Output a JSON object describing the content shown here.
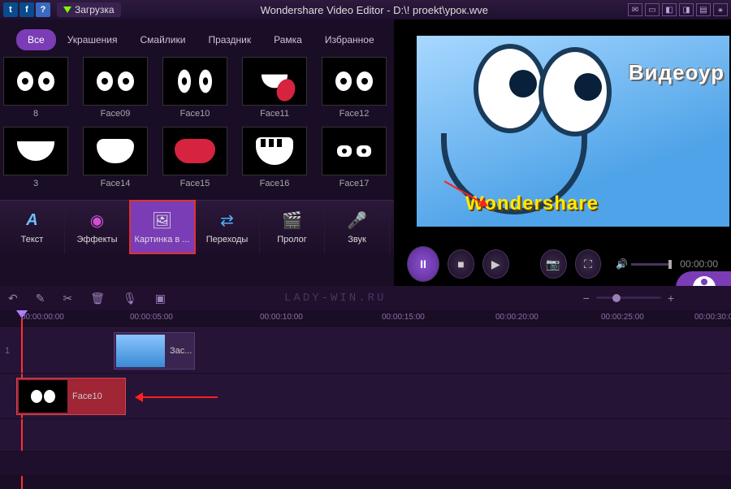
{
  "titlebar": {
    "download": "Загрузка",
    "title": "Wondershare Video Editor - D:\\! proekt\\урок.wve"
  },
  "categories": [
    "Все",
    "Украшения",
    "Смайлики",
    "Праздник",
    "Рамка",
    "Избранное"
  ],
  "active_category": 0,
  "thumbs": {
    "row1": [
      "8",
      "Face09",
      "Face10",
      "Face11",
      "Face12"
    ],
    "row2": [
      "3",
      "Face14",
      "Face15",
      "Face16",
      "Face17"
    ]
  },
  "tools": [
    {
      "label": "Текст",
      "icon": "text-icon"
    },
    {
      "label": "Эффекты",
      "icon": "effects-icon"
    },
    {
      "label": "Картинка в ...",
      "icon": "pip-icon"
    },
    {
      "label": "Переходы",
      "icon": "transitions-icon"
    },
    {
      "label": "Пролог",
      "icon": "intro-icon"
    },
    {
      "label": "Звук",
      "icon": "sound-icon"
    }
  ],
  "active_tool": 2,
  "preview": {
    "overlay1": "Видеоур",
    "overlay2": "Wondershare"
  },
  "timecode": "00:00:00",
  "watermark": "LADY-WIN.RU",
  "ruler": [
    "00:00:00:00",
    "00:00:05:00",
    "00:00:10:00",
    "00:00:15:00",
    "00:00:20:00",
    "00:00:25:00",
    "00:00:30:0"
  ],
  "tracks": {
    "t1": {
      "num": "1",
      "clip_label": "Зас..."
    },
    "t2": {
      "clip_label": "Face10"
    }
  }
}
